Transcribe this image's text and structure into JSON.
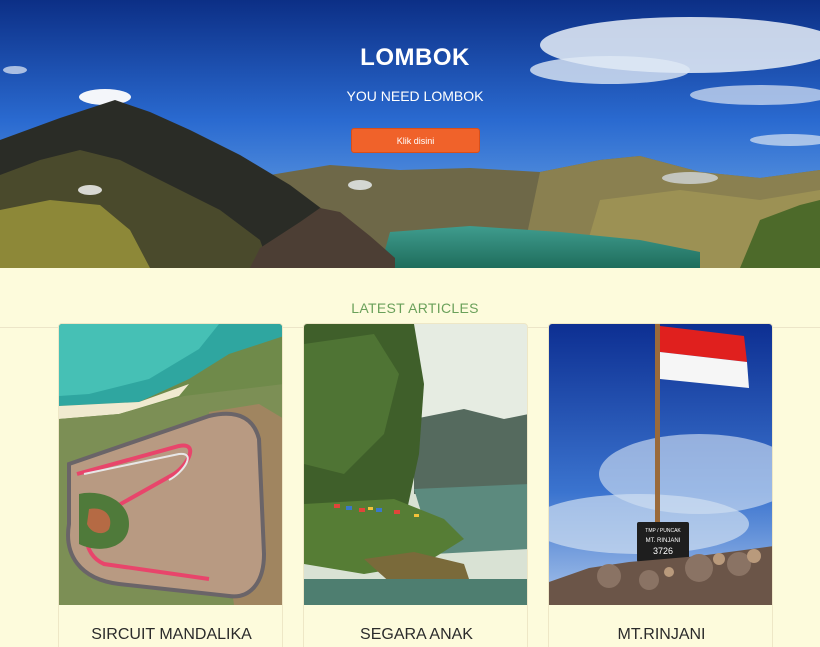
{
  "hero": {
    "title": "LOMBOK",
    "subtitle": "YOU NEED LOMBOK",
    "button_label": "Klik disini"
  },
  "section": {
    "title": "LATEST ARTICLES"
  },
  "articles": [
    {
      "title": "SIRCUIT MANDALIKA"
    },
    {
      "title": "SEGARA ANAK"
    },
    {
      "title": "MT.RINJANI"
    }
  ],
  "summit_sign": {
    "line1": "TMP / PUNCAK",
    "line2": "MT. RINJANI",
    "line3": "3726"
  },
  "colors": {
    "accent_button": "#f0622a",
    "section_title": "#6aa05a",
    "background": "#fdfbdc"
  }
}
